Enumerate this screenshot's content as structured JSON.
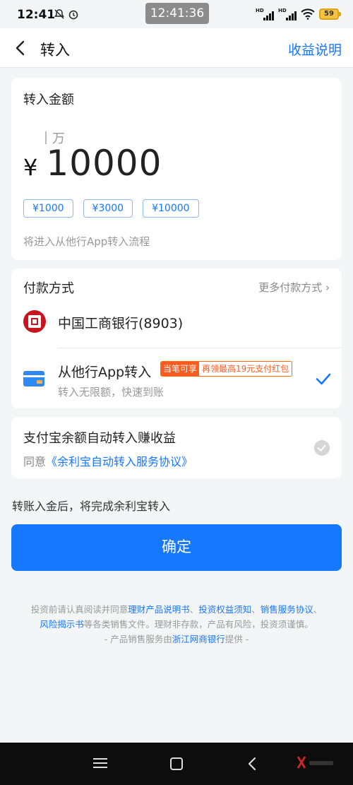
{
  "status_bar": {
    "time": "12:41",
    "center_time": "12:41:36",
    "battery": "59"
  },
  "nav": {
    "title": "转入",
    "right_link": "收益说明"
  },
  "amount": {
    "label": "转入金额",
    "unit_hint": "万",
    "currency": "¥",
    "value": "10000",
    "presets": [
      "¥1000",
      "¥3000",
      "¥10000"
    ],
    "flow_hint": "将进入从他行App转入流程"
  },
  "payment": {
    "title": "付款方式",
    "more": "更多付款方式 ",
    "more_chevron": "›",
    "bank": "中国工商银行(8903)",
    "other_title": "从他行App转入",
    "promo_tag": "当笔可享",
    "promo_text": "再领最高19元支付红包",
    "other_sub": "转入无限额，快速到账"
  },
  "auto_transfer": {
    "title": "支付宝余额自动转入赚收益",
    "agree_prefix": "同意",
    "agree_link": "《余利宝自动转入服务协议》"
  },
  "after_hint": "转账入金后，将完成余利宝转入",
  "confirm_label": "确定",
  "disclaimer": {
    "prefix": "投资前请认真阅读并同意",
    "doc1": "理财产品说明书",
    "sep1": "、",
    "doc2": "投资权益须知",
    "sep2": "、",
    "doc3": "销售服务协议",
    "sep3": "、",
    "doc4": "风险揭示书",
    "suffix": "等各类销售文件。理财非存款，产品有风险，投资须谨慎。",
    "provider_prefix": "- 产品销售服务由",
    "provider_bank": "浙江网商银行",
    "provider_suffix": "提供 -"
  },
  "colors": {
    "accent": "#1677ff",
    "promo": "#ff5a1f",
    "icbc": "#c7161d"
  },
  "icons": [
    "back-arrow-icon",
    "icbc-logo-icon",
    "bank-card-icon",
    "check-icon",
    "menu-icon",
    "home-icon",
    "back-icon"
  ]
}
